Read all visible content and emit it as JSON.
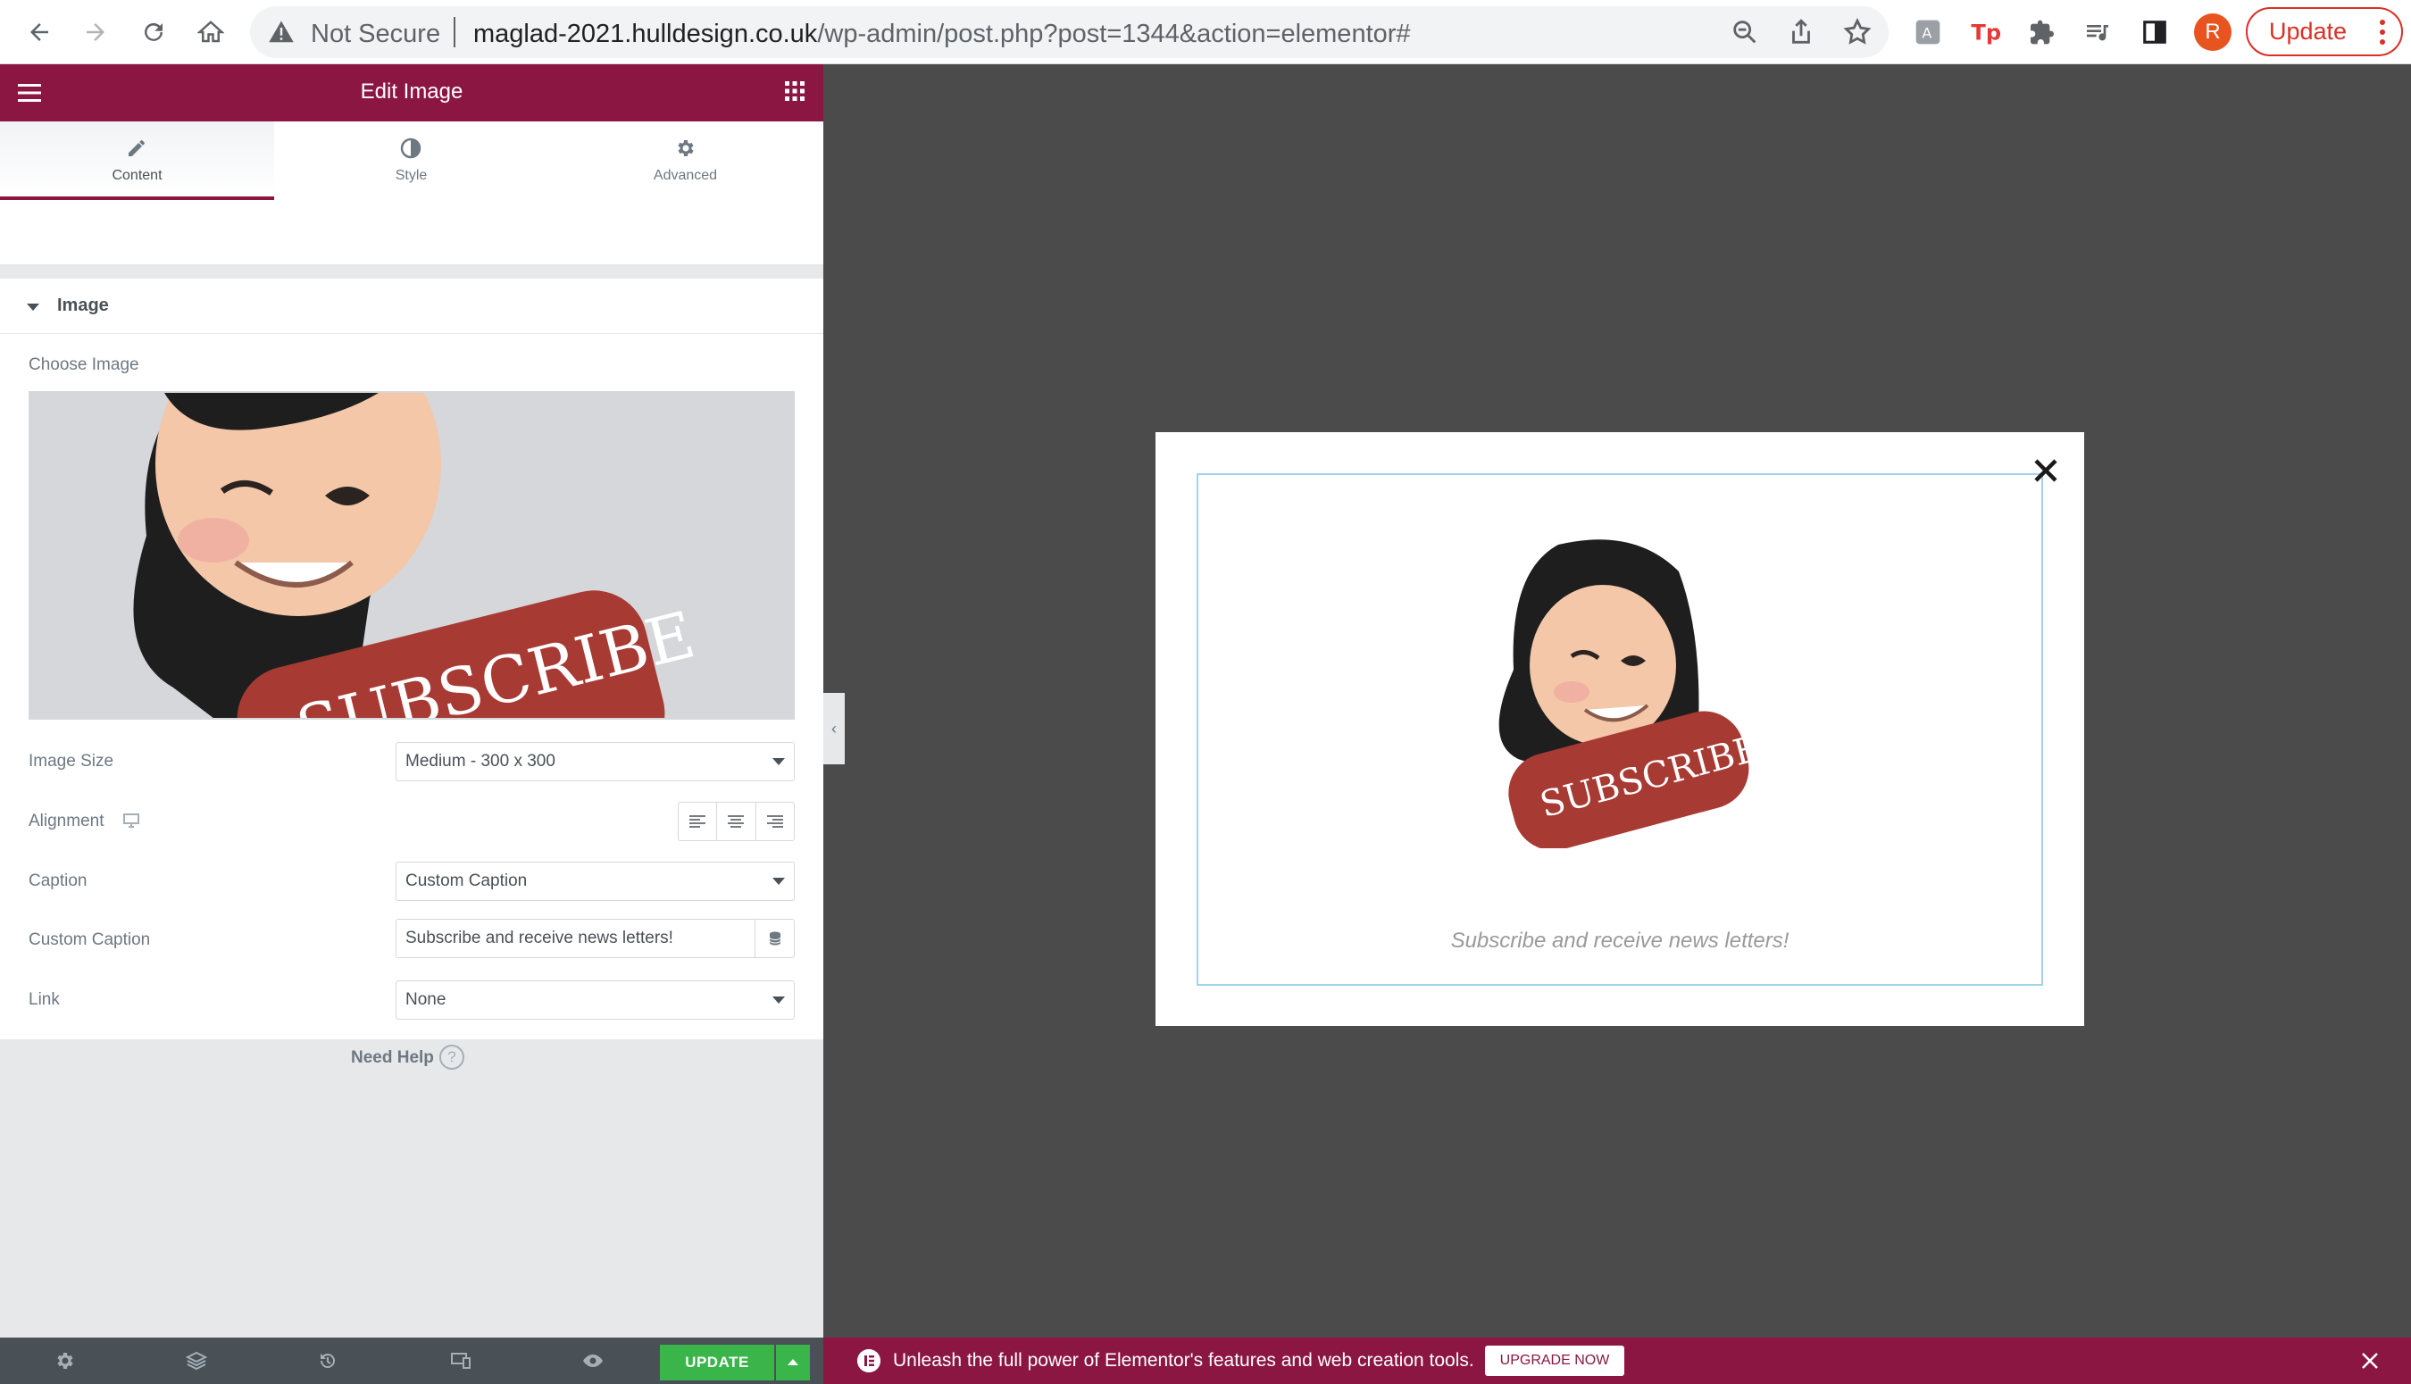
{
  "browser": {
    "security_label": "Not Secure",
    "url_domain": "maglad-2021.hulldesign.co.uk",
    "url_path": "/wp-admin/post.php?post=1344&action=elementor#",
    "avatar_letter": "R",
    "update_label": "Update"
  },
  "panel": {
    "title": "Edit Image",
    "tabs": [
      {
        "label": "Content",
        "icon": "pencil-icon"
      },
      {
        "label": "Style",
        "icon": "half-circle-icon"
      },
      {
        "label": "Advanced",
        "icon": "gear-icon"
      }
    ],
    "section_label": "Image",
    "choose_image_label": "Choose Image",
    "image_size_label": "Image Size",
    "image_size_value": "Medium - 300 x 300",
    "alignment_label": "Alignment",
    "caption_label": "Caption",
    "caption_value": "Custom Caption",
    "custom_caption_label": "Custom Caption",
    "custom_caption_value": "Subscribe and receive news letters!",
    "link_label": "Link",
    "link_value": "None",
    "need_help": "Need Help",
    "update_button": "UPDATE"
  },
  "image": {
    "subscribe_text": "SUBSCRIBE"
  },
  "preview": {
    "caption": "Subscribe and receive news letters!",
    "subscribe_text": "SUBSCRIBE"
  },
  "promo": {
    "text": "Unleash the full power of Elementor's features and web creation tools.",
    "button": "UPGRADE NOW"
  },
  "colors": {
    "brand": "#8b1641",
    "update_green": "#39b54a",
    "canvas": "#4b4b4b",
    "chrome_alert": "#d93025"
  }
}
